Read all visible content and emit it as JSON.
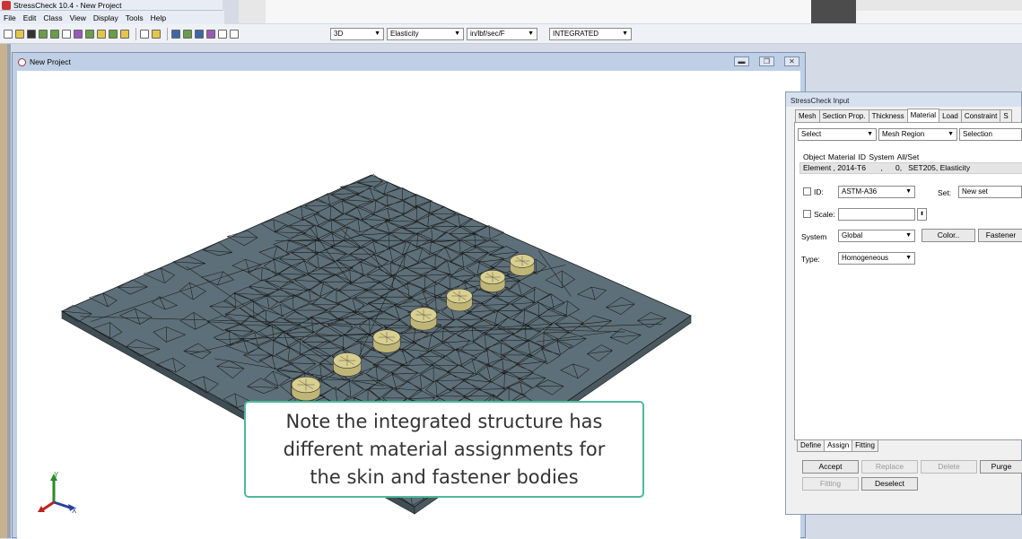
{
  "app": {
    "title": "StressCheck 10.4 - New Project"
  },
  "menu": [
    "File",
    "Edit",
    "Class",
    "View",
    "Display",
    "Tools",
    "Help"
  ],
  "toolbar": {
    "mode_select": "3D",
    "analysis_select": "Elasticity",
    "units_select": "in/lbf/sec/F",
    "structure_select": "INTEGRATED"
  },
  "project_window": {
    "title": "New Project",
    "minimize": "▬",
    "restore": "❐",
    "close": "✕"
  },
  "callout": {
    "lines": [
      "Note the integrated structure has",
      "different material assignments for",
      "the skin and fastener bodies"
    ]
  },
  "triad": {
    "y": "Y",
    "x": "X"
  },
  "input_panel": {
    "title": "StressCheck Input",
    "tabs": [
      "Mesh",
      "Section Prop.",
      "Thickness",
      "Material",
      "Load",
      "Constraint",
      "S"
    ],
    "active_tab": "Material",
    "selects": {
      "object": "Select",
      "region": "Mesh Region",
      "selection": "Selection"
    },
    "list": {
      "header": "Object   Material ID   System   All/Set",
      "row": "Element , 2014-T6       ,      0,   SET205, Elasticity"
    },
    "id_label": "ID:",
    "id_value": "ASTM-A36",
    "set_label": "Set:",
    "set_value": "New set",
    "scale_label": "Scale:",
    "scale_value": "",
    "system_label": "System",
    "system_value": "Global",
    "color_button": "Color..",
    "fastener_button": "Fastener",
    "type_label": "Type:",
    "type_value": "Homogeneous",
    "bottom_tabs": [
      "Define",
      "Assign",
      "Fitting"
    ],
    "active_bottom_tab": "Assign",
    "buttons": {
      "accept": "Accept",
      "replace": "Replace",
      "delete": "Delete",
      "purge": "Purge",
      "fitting": "Fitting",
      "deselect": "Deselect"
    }
  },
  "colors": {
    "plate": "#5d6f78",
    "fastener": "#d9cf8f",
    "callout_border": "#4fb99a"
  }
}
